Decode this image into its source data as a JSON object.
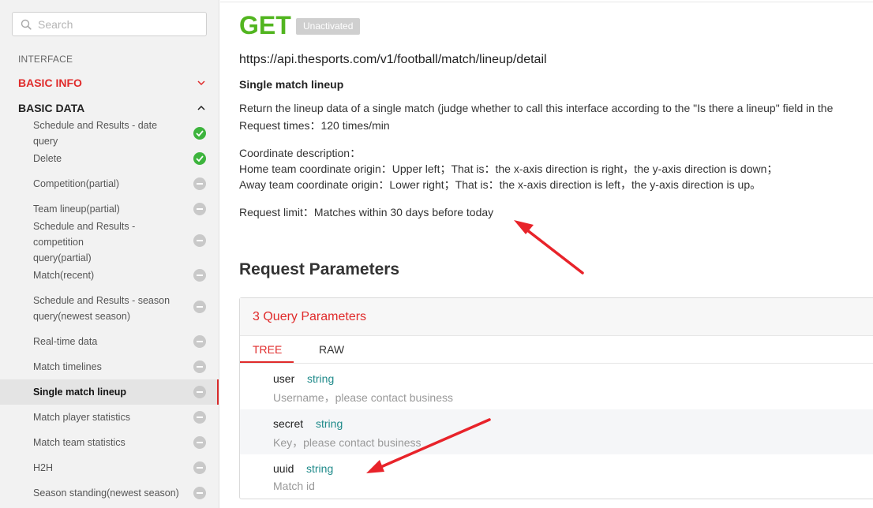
{
  "sidebar": {
    "search_placeholder": "Search",
    "section_label": "INTERFACE",
    "groups": [
      {
        "label": "BASIC INFO",
        "expanded": false
      },
      {
        "label": "BASIC DATA",
        "expanded": true
      }
    ],
    "items": [
      {
        "label": "Schedule and Results - date query",
        "status": "done"
      },
      {
        "label": "Delete",
        "status": "done"
      },
      {
        "label": "Competition(partial)",
        "status": "pending"
      },
      {
        "label": "Team lineup(partial)",
        "status": "pending"
      },
      {
        "label": "Schedule and Results - competition",
        "label2": "query(partial)",
        "status": "pending"
      },
      {
        "label": "Match(recent)",
        "status": "pending"
      },
      {
        "label": "Schedule and Results - season",
        "label2": "query(newest season)",
        "status": "pending"
      },
      {
        "label": "Real-time data",
        "status": "pending"
      },
      {
        "label": "Match timelines",
        "status": "pending"
      },
      {
        "label": "Single match lineup",
        "status": "pending",
        "active": true
      },
      {
        "label": "Match player statistics",
        "status": "pending"
      },
      {
        "label": "Match team statistics",
        "status": "pending"
      },
      {
        "label": "H2H",
        "status": "pending"
      },
      {
        "label": "Season standing(newest season)",
        "status": "pending"
      }
    ]
  },
  "main": {
    "method": "GET",
    "badge": "Unactivated",
    "url": "https://api.thesports.com/v1/football/match/lineup/detail",
    "subtitle": "Single match lineup",
    "description": [
      "Return the lineup data of a single match (judge whether to call this interface according to the \"Is there a lineup\" field in the",
      "Request times：120 times/min",
      "Coordinate description：",
      "Home team coordinate origin：Upper left；That is：the x-axis direction is right，the y-axis direction is down；",
      "Away team coordinate origin：Lower right；That is：the x-axis direction is left，the y-axis direction is up。",
      "Request limit：Matches within 30 days before today"
    ],
    "request_title": "Request Parameters",
    "params_count": "3 Query Parameters",
    "tabs": [
      "TREE",
      "RAW"
    ],
    "active_tab": "TREE",
    "params": [
      {
        "name": "user",
        "type": "string",
        "desc": "Username，please contact business"
      },
      {
        "name": "secret",
        "type": "string",
        "desc": "Key，please contact business"
      },
      {
        "name": "uuid",
        "type": "string",
        "desc": "Match id"
      }
    ]
  },
  "colors": {
    "accent_red": "#e02b2b",
    "method_green": "#52b520",
    "done_green": "#3db43d",
    "type_teal": "#1f8a8a",
    "annotation_red": "#e8232a"
  },
  "icons": [
    "search-icon",
    "chevron-down-icon",
    "chevron-up-icon",
    "check-icon",
    "minus-icon"
  ]
}
